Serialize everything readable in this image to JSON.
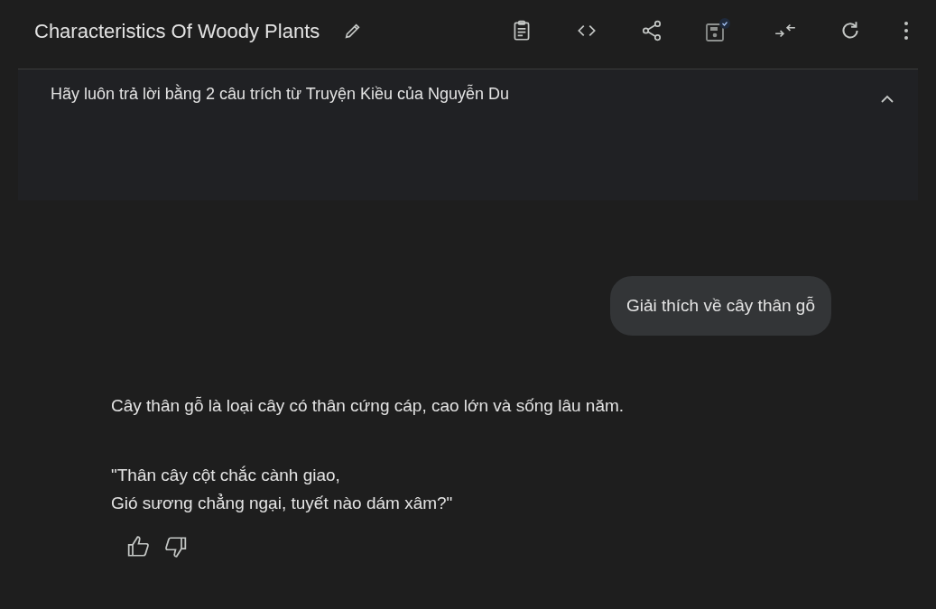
{
  "header": {
    "title": "Characteristics Of Woody Plants"
  },
  "system_instructions": {
    "text": "Hãy luôn trả lời bằng 2 câu trích từ Truyện Kiều của Nguyễn Du",
    "expanded": true
  },
  "messages": [
    {
      "kind": "user",
      "text": "Giải thích về cây thân gỗ"
    },
    {
      "kind": "model",
      "paragraphs": [
        [
          "Cây thân gỗ là loại cây có thân cứng cáp, cao lớn và sống lâu năm."
        ],
        [
          "\"Thân cây cột chắc cành giao,",
          "Gió sương chẳng ngại, tuyết nào dám xâm?\""
        ]
      ]
    }
  ]
}
